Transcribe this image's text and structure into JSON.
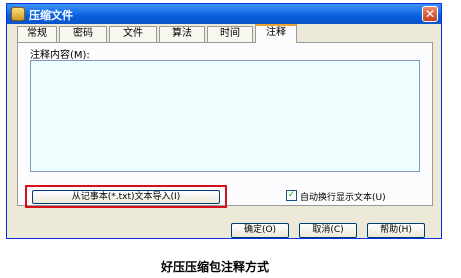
{
  "window": {
    "title": "压缩文件"
  },
  "tabs": [
    {
      "label": "常规"
    },
    {
      "label": "密码"
    },
    {
      "label": "文件"
    },
    {
      "label": "算法"
    },
    {
      "label": "时间"
    },
    {
      "label": "注释",
      "active": true
    }
  ],
  "comment": {
    "label": "注释内容(M):",
    "value": "",
    "import_button": "从记事本(*.txt)文本导入(I)",
    "auto_wrap_label": "自动换行显示文本(U)",
    "auto_wrap_checked": true
  },
  "buttons": {
    "ok": "确定(O)",
    "cancel": "取消(C)",
    "help": "帮助(H)"
  },
  "caption": "好压压缩包注释方式",
  "icons": {
    "title": "archive-icon",
    "close": "close-icon",
    "check": "check-icon"
  },
  "colors": {
    "highlight": "#d80f1c",
    "textarea_bg": "#eefefe"
  }
}
